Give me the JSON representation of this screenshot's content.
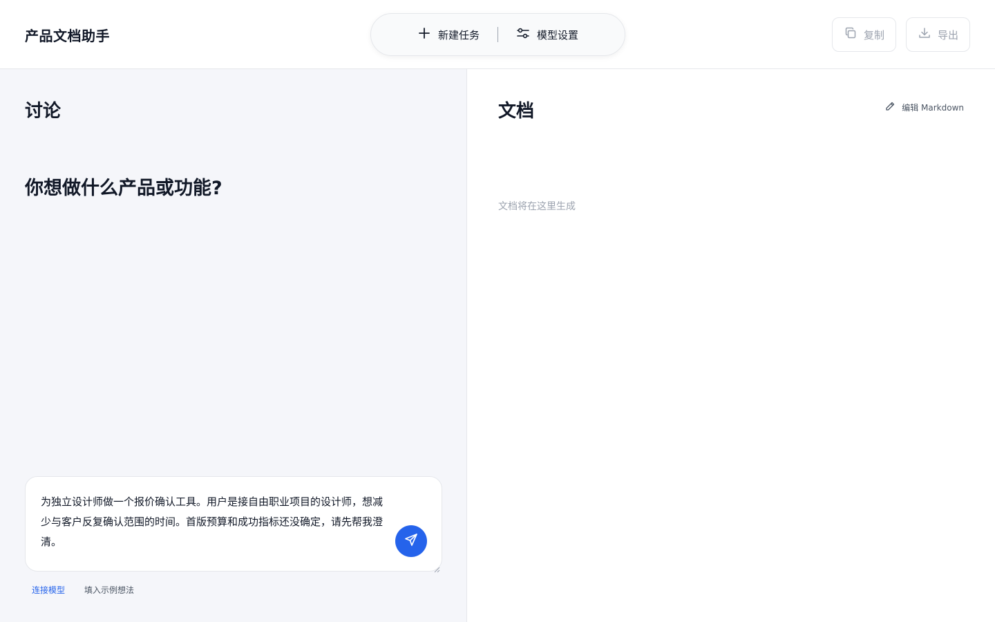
{
  "header": {
    "app_title": "产品文档助手",
    "new_task_label": "新建任务",
    "model_settings_label": "模型设置",
    "copy_label": "复制",
    "export_label": "导出"
  },
  "discussion": {
    "title": "讨论",
    "prompt_heading": "你想做什么产品或功能?",
    "composer_value": "为独立设计师做一个报价确认工具。用户是接自由职业项目的设计师，想减少与客户反复确认范围的时间。首版预算和成功指标还没确定，请先帮我澄清。",
    "links": {
      "connect_model": "连接模型",
      "fill_example": "填入示例想法"
    }
  },
  "document": {
    "title": "文档",
    "edit_markdown_label": "编辑 Markdown",
    "placeholder": "文档将在这里生成"
  },
  "icons": {
    "new_task": "plus-icon",
    "model_settings": "sliders-icon",
    "copy": "copy-icon",
    "export": "download-icon",
    "send": "send-icon",
    "edit": "pencil-icon"
  },
  "colors": {
    "accent": "#2563eb",
    "left_pane_bg": "#f5f6fa",
    "muted_text": "#9ca3af"
  }
}
